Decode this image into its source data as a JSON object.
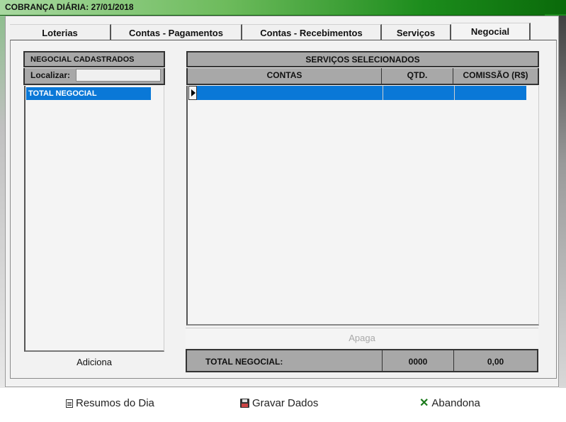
{
  "window": {
    "title": "COBRANÇA DIÁRIA: 27/01/2018"
  },
  "tabs": [
    {
      "label": "Loterias",
      "active": false
    },
    {
      "label": "Contas - Pagamentos",
      "active": false
    },
    {
      "label": "Contas - Recebimentos",
      "active": false
    },
    {
      "label": "Serviços",
      "active": false
    },
    {
      "label": "Negocial",
      "active": true
    }
  ],
  "left_panel": {
    "header": "NEGOCIAL CADASTRADOS",
    "search_label": "Localizar:",
    "search_value": "",
    "items": [
      {
        "label": "TOTAL NEGOCIAL",
        "selected": true
      }
    ],
    "add_button": "Adiciona"
  },
  "right_panel": {
    "header": "SERVIÇOS SELECIONADOS",
    "columns": [
      "CONTAS",
      "QTD.",
      "COMISSÃO (R$)"
    ],
    "rows": [
      {
        "contas": "",
        "qtd": "",
        "comissao": "",
        "selected": true
      }
    ],
    "delete_button": "Apaga",
    "total": {
      "label": "TOTAL NEGOCIAL:",
      "qtd": "0000",
      "comissao": "0,00"
    }
  },
  "bottom": {
    "summary_button": "Resumos do Dia",
    "save_button": "Gravar Dados",
    "abort_button": "Abandona"
  },
  "colors": {
    "selection": "#0a78d7",
    "header_gray": "#a8a8a8",
    "title_green": "#1c8c1c"
  }
}
